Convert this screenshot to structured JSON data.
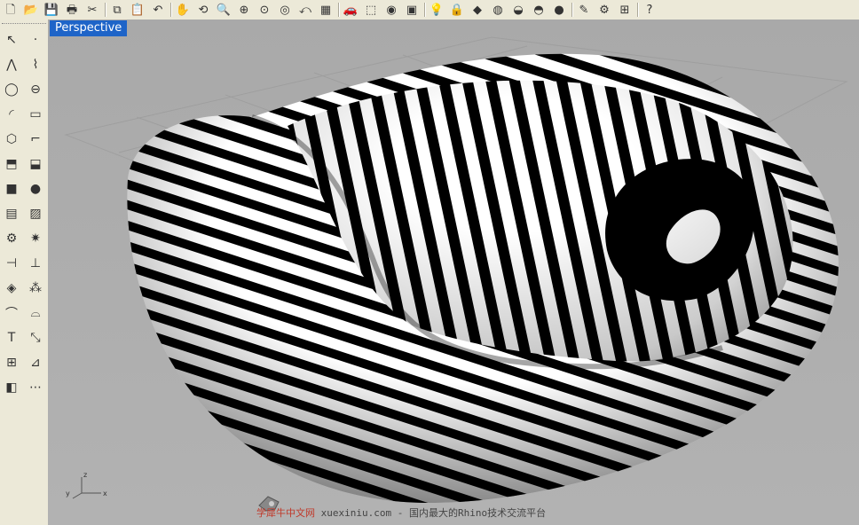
{
  "viewport": {
    "title": "Perspective",
    "axis": {
      "x": "x",
      "y": "y",
      "z": "z"
    }
  },
  "watermark": {
    "brand": "学犀牛中文网",
    "url": "xuexiniu.com",
    "tagline": "- 国内最大的Rhino技术交流平台"
  },
  "toolbar": {
    "buttons": [
      {
        "name": "new-file-icon",
        "glyph": "🗋"
      },
      {
        "name": "open-folder-icon",
        "glyph": "📂"
      },
      {
        "name": "save-icon",
        "glyph": "💾"
      },
      {
        "name": "print-icon",
        "glyph": "🖶"
      },
      {
        "name": "cut-icon",
        "glyph": "✂"
      },
      {
        "name": "copy-icon",
        "glyph": "⧉"
      },
      {
        "name": "paste-icon",
        "glyph": "📋"
      },
      {
        "name": "undo-icon",
        "glyph": "↶"
      },
      {
        "name": "pan-hand-icon",
        "glyph": "✋"
      },
      {
        "name": "rotate-view-icon",
        "glyph": "⟲"
      },
      {
        "name": "zoom-icon",
        "glyph": "🔍"
      },
      {
        "name": "zoom-window-icon",
        "glyph": "⊕"
      },
      {
        "name": "zoom-extents-icon",
        "glyph": "⊙"
      },
      {
        "name": "zoom-selected-icon",
        "glyph": "◎"
      },
      {
        "name": "undo-view-icon",
        "glyph": "⤺"
      },
      {
        "name": "four-viewports-icon",
        "glyph": "▦"
      },
      {
        "name": "car-icon",
        "glyph": "🚗"
      },
      {
        "name": "construction-plane-icon",
        "glyph": "⬚"
      },
      {
        "name": "snap-icon",
        "glyph": "◉"
      },
      {
        "name": "osnap-icon",
        "glyph": "▣"
      },
      {
        "name": "light-bulb-icon",
        "glyph": "💡"
      },
      {
        "name": "lock-icon",
        "glyph": "🔒"
      },
      {
        "name": "layer-icon",
        "glyph": "◆"
      },
      {
        "name": "color-wheel-icon",
        "glyph": "◍"
      },
      {
        "name": "wireframe-sphere-icon",
        "glyph": "◒"
      },
      {
        "name": "shaded-sphere-icon",
        "glyph": "◓"
      },
      {
        "name": "render-sphere-icon",
        "glyph": "●"
      },
      {
        "name": "properties-icon",
        "glyph": "✎"
      },
      {
        "name": "options-gear-icon",
        "glyph": "⚙"
      },
      {
        "name": "grid-snap-icon",
        "glyph": "⊞"
      },
      {
        "name": "help-icon",
        "glyph": "?"
      }
    ]
  },
  "leftbar": {
    "buttons": [
      {
        "name": "select-arrow-icon",
        "glyph": "↖"
      },
      {
        "name": "point-icon",
        "glyph": "·"
      },
      {
        "name": "polyline-icon",
        "glyph": "⋀"
      },
      {
        "name": "curve-points-icon",
        "glyph": "⌇"
      },
      {
        "name": "circle-icon",
        "glyph": "◯"
      },
      {
        "name": "ellipse-icon",
        "glyph": "⊖"
      },
      {
        "name": "arc-icon",
        "glyph": "◜"
      },
      {
        "name": "rectangle-icon",
        "glyph": "▭"
      },
      {
        "name": "polygon-icon",
        "glyph": "⬡"
      },
      {
        "name": "fillet-curve-icon",
        "glyph": "⌐"
      },
      {
        "name": "surface-points-icon",
        "glyph": "⬒"
      },
      {
        "name": "surface-edit-icon",
        "glyph": "⬓"
      },
      {
        "name": "box-solid-icon",
        "glyph": "■"
      },
      {
        "name": "sphere-solid-icon",
        "glyph": "●"
      },
      {
        "name": "cylinder-icon",
        "glyph": "▤"
      },
      {
        "name": "mesh-icon",
        "glyph": "▨"
      },
      {
        "name": "transform-gear-icon",
        "glyph": "⚙"
      },
      {
        "name": "explode-icon",
        "glyph": "✷"
      },
      {
        "name": "split-icon",
        "glyph": "⊣"
      },
      {
        "name": "trim-icon",
        "glyph": "⊥"
      },
      {
        "name": "boolean-icon",
        "glyph": "◈"
      },
      {
        "name": "group-icon",
        "glyph": "⁂"
      },
      {
        "name": "fillet-edge-icon",
        "glyph": "⌒"
      },
      {
        "name": "blend-icon",
        "glyph": "⌓"
      },
      {
        "name": "text-icon",
        "glyph": "T"
      },
      {
        "name": "scale-icon",
        "glyph": "⤡"
      },
      {
        "name": "array-icon",
        "glyph": "⊞"
      },
      {
        "name": "dimension-icon",
        "glyph": "⊿"
      },
      {
        "name": "solid-tools-icon",
        "glyph": "◧"
      },
      {
        "name": "more-tools-icon",
        "glyph": "⋯"
      }
    ]
  }
}
